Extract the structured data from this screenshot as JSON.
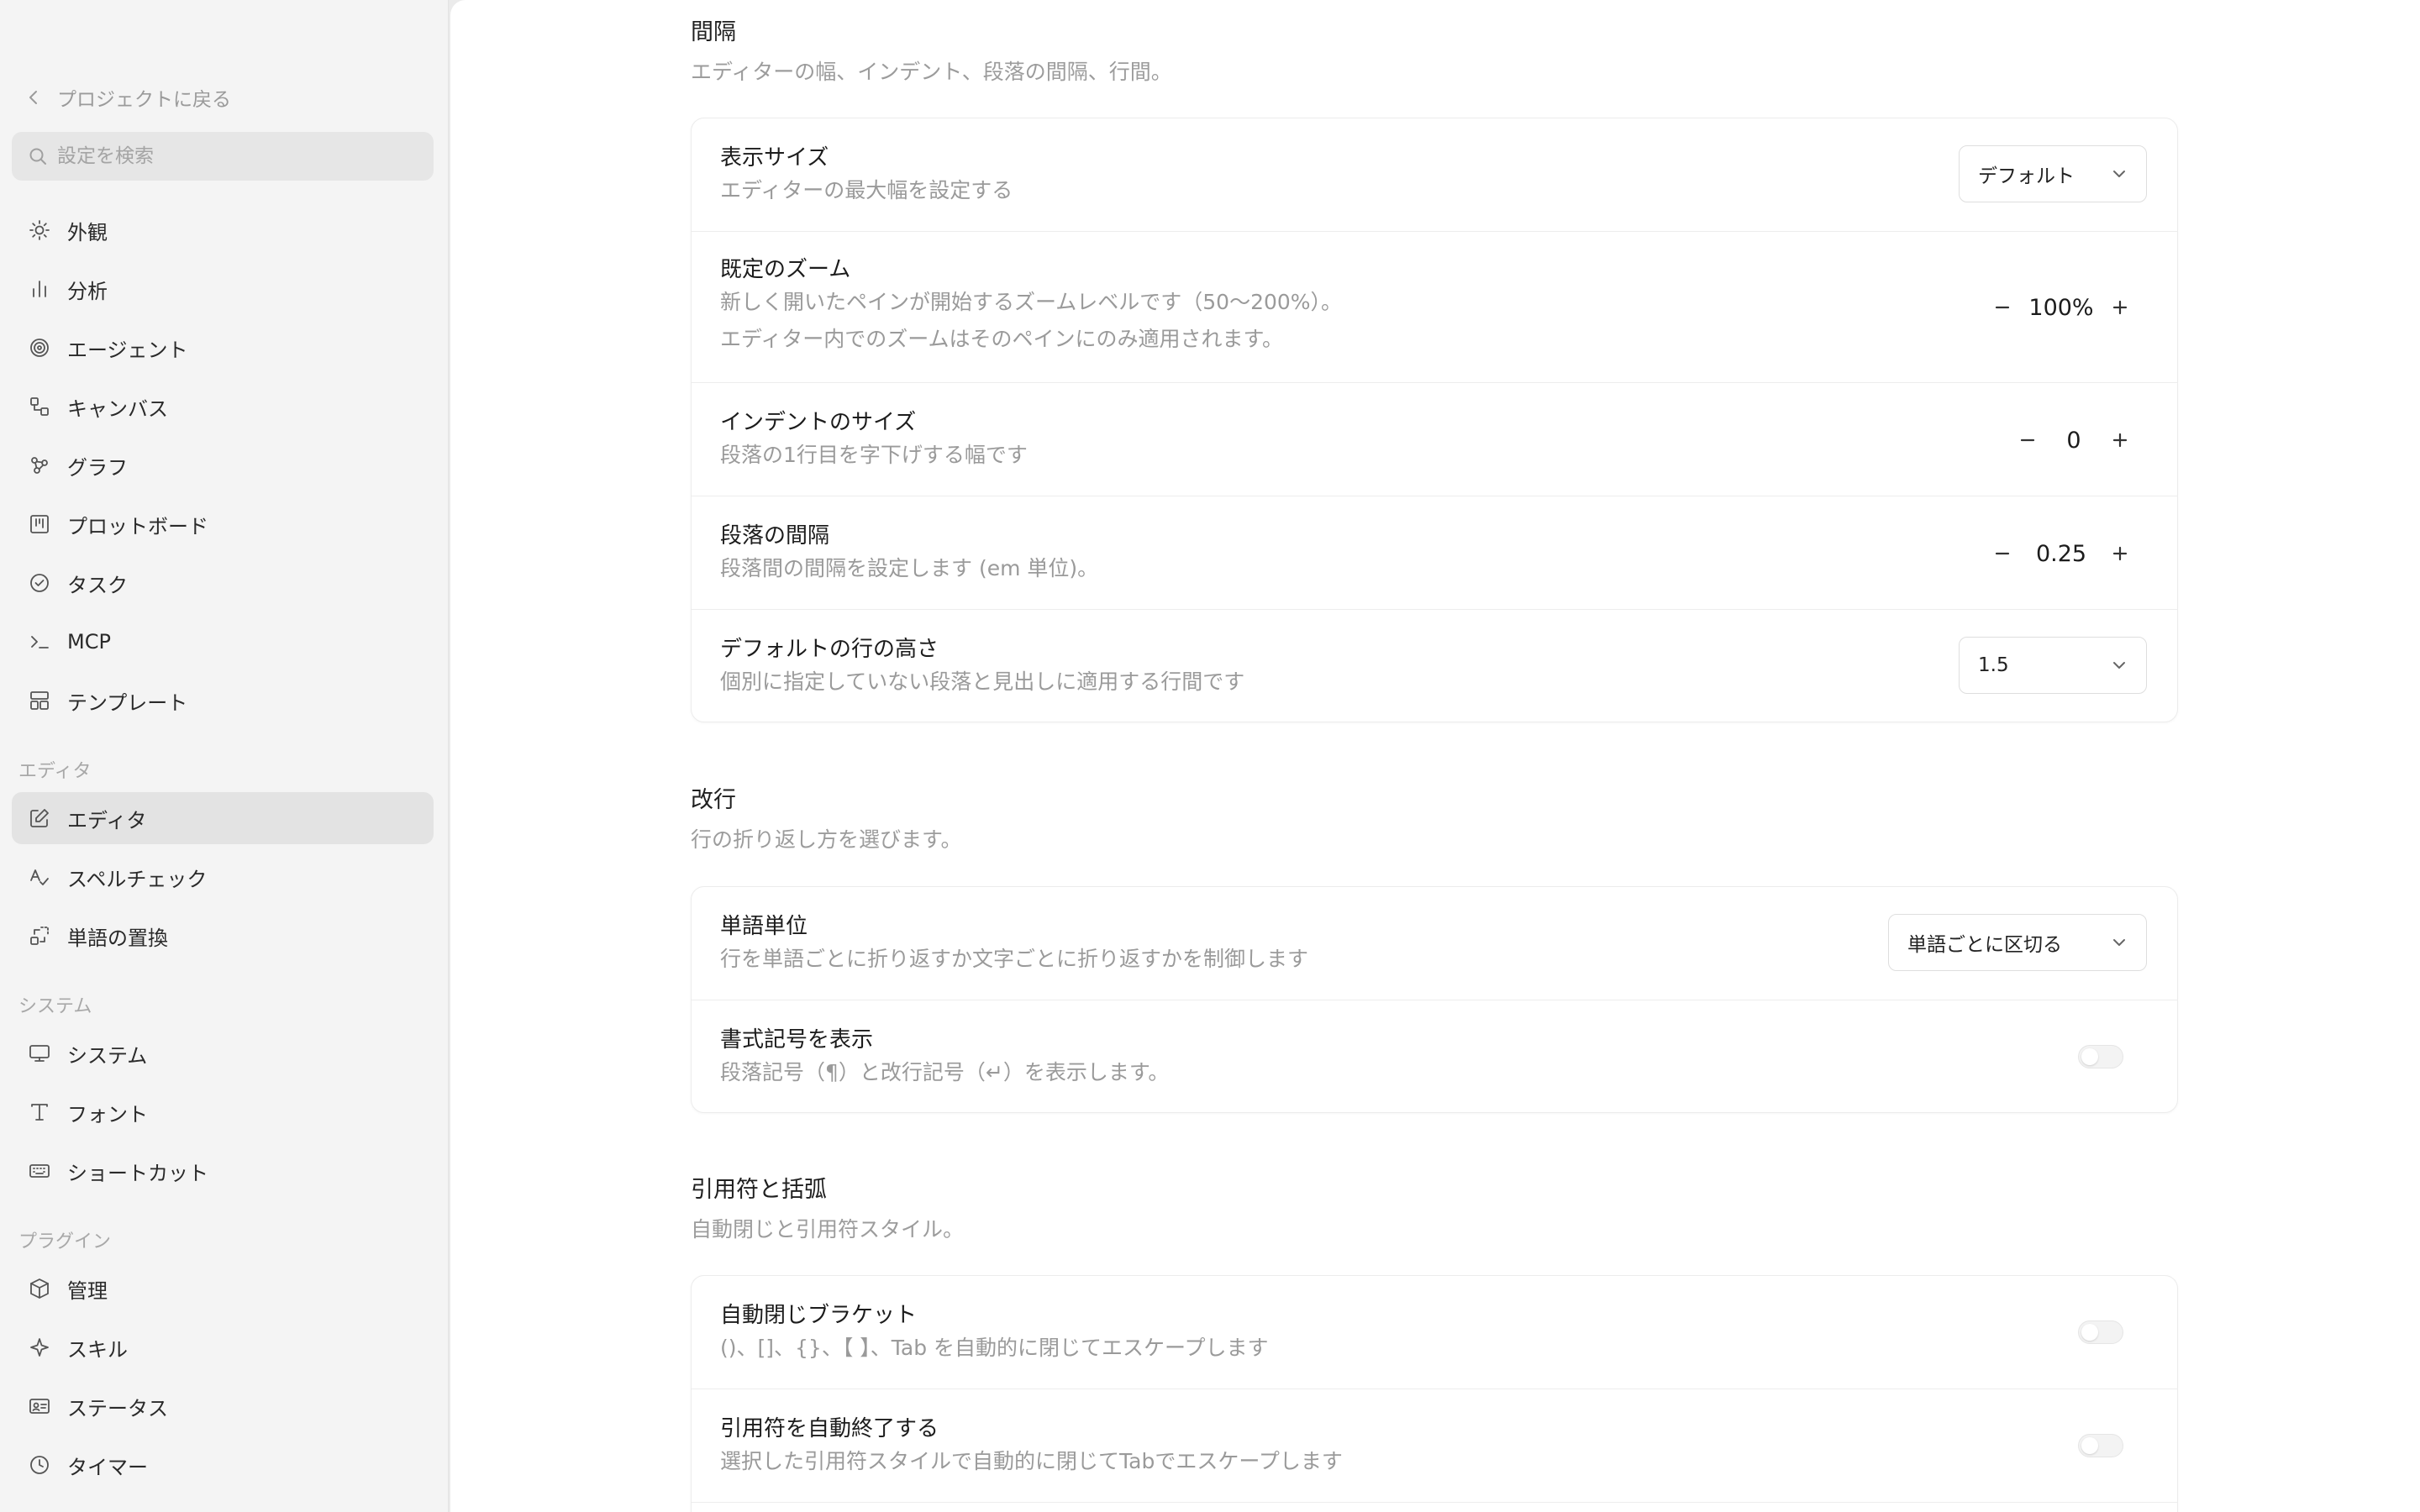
{
  "sidebar": {
    "back_label": "プロジェクトに戻る",
    "search_placeholder": "設定を検索",
    "items_top": [
      {
        "label": "外観",
        "icon": "sun-icon"
      },
      {
        "label": "分析",
        "icon": "bar-chart-icon"
      },
      {
        "label": "エージェント",
        "icon": "spiral-icon"
      },
      {
        "label": "キャンバス",
        "icon": "canvas-icon"
      },
      {
        "label": "グラフ",
        "icon": "graph-icon"
      },
      {
        "label": "プロットボード",
        "icon": "board-icon"
      },
      {
        "label": "タスク",
        "icon": "check-circle-icon"
      },
      {
        "label": "MCP",
        "icon": "terminal-icon"
      },
      {
        "label": "テンプレート",
        "icon": "layout-icon"
      }
    ],
    "section_editor": "エディタ",
    "items_editor": [
      {
        "label": "エディタ",
        "icon": "pencil-square-icon",
        "active": true
      },
      {
        "label": "スペルチェック",
        "icon": "spellcheck-icon"
      },
      {
        "label": "単語の置換",
        "icon": "replace-icon"
      }
    ],
    "section_system": "システム",
    "items_system": [
      {
        "label": "システム",
        "icon": "monitor-icon"
      },
      {
        "label": "フォント",
        "icon": "type-icon"
      },
      {
        "label": "ショートカット",
        "icon": "keyboard-icon"
      }
    ],
    "section_plugin": "プラグイン",
    "items_plugin": [
      {
        "label": "管理",
        "icon": "box-icon"
      },
      {
        "label": "スキル",
        "icon": "sparkle-icon"
      },
      {
        "label": "ステータス",
        "icon": "id-card-icon"
      },
      {
        "label": "タイマー",
        "icon": "clock-icon"
      }
    ]
  },
  "spacing": {
    "title": "間隔",
    "desc": "エディターの幅、インデント、段落の間隔、行間。",
    "display_size": {
      "title": "表示サイズ",
      "desc": "エディターの最大幅を設定する",
      "value": "デフォルト"
    },
    "default_zoom": {
      "title": "既定のズーム",
      "desc1": "新しく開いたペインが開始するズームレベルです（50〜200%）。",
      "desc2": "エディター内でのズームはそのペインにのみ適用されます。",
      "value": "100%"
    },
    "indent": {
      "title": "インデントのサイズ",
      "desc": "段落の1行目を字下げする幅です",
      "value": "0"
    },
    "paragraph": {
      "title": "段落の間隔",
      "desc": "段落間の間隔を設定します (em 単位)。",
      "value": "0.25"
    },
    "line_height": {
      "title": "デフォルトの行の高さ",
      "desc": "個別に指定していない段落と見出しに適用する行間です",
      "value": "1.5"
    }
  },
  "wrap": {
    "title": "改行",
    "desc": "行の折り返し方を選びます。",
    "word_unit": {
      "title": "単語単位",
      "desc": "行を単語ごとに折り返すか文字ごとに折り返すかを制御します",
      "value": "単語ごとに区切る"
    },
    "show_marks": {
      "title": "書式記号を表示",
      "desc": "段落記号（¶）と改行記号（↵）を表示します。",
      "on": false
    }
  },
  "quotes": {
    "title": "引用符と括弧",
    "desc": "自動閉じと引用符スタイル。",
    "auto_bracket": {
      "title": "自動閉じブラケット",
      "desc": "()、[]、{}、【 】、Tab を自動的に閉じてエスケープします",
      "on": false
    },
    "auto_quote": {
      "title": "引用符を自動終了する",
      "desc": "選択した引用符スタイルで自動的に閉じてTabでエスケープします",
      "on": false
    }
  }
}
